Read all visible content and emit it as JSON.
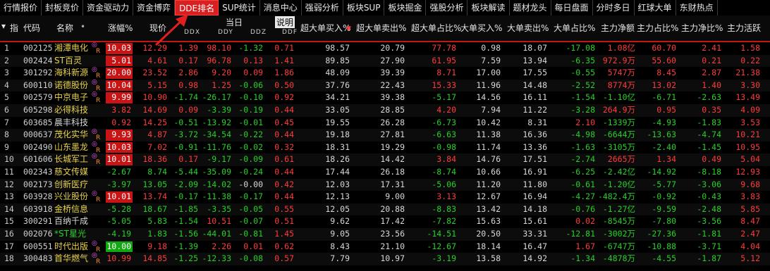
{
  "tabs": [
    "行情报价",
    "封板竞价",
    "资金驱动力",
    "资金博弈",
    "DDE排名",
    "SUP统计",
    "消息中心",
    "强弱分析",
    "板块SUP",
    "板块掘金",
    "强股分析",
    "板块解读",
    "题材龙头",
    "每日盘面",
    "分时多日",
    "红球大单",
    "东财热点"
  ],
  "active_tab": "DDE排名",
  "header": {
    "index": "指",
    "code": "代码",
    "name": "名称",
    "dot": "•",
    "change": "涨幅%",
    "price": "现价",
    "today": "当日",
    "explain": "说明",
    "ddx": "DDX",
    "ddy": "DDY",
    "ddz": "DDZ",
    "ddf": "DDF",
    "cols": [
      "超大单买入%",
      "超大单卖出%",
      "超大单占比%",
      "大单买入%",
      "大单卖出%",
      "大单占比%",
      "主力净额",
      "主力占比%",
      "主力净比%",
      "主力活跃"
    ]
  },
  "rows": [
    {
      "i": "1",
      "code": "002125",
      "name": "湘潭电化",
      "badge": "R",
      "chg": "10.03",
      "chgbox": "red",
      "price": "12.29",
      "ddx": "1.39",
      "ddy": "98.10",
      "ddz": "-1.32",
      "ddf": "0.71",
      "c1": "98.57",
      "c2": "20.79",
      "c3": "77.78",
      "c4": "0.98",
      "c5": "18.07",
      "c6": "-17.08",
      "c7": "1.08亿",
      "c8": "60.70",
      "c9": "2.41",
      "c10": "1.58"
    },
    {
      "i": "2",
      "code": "002424",
      "name": "ST百灵",
      "badge": "",
      "chg": "5.01",
      "chgbox": "red",
      "price": "4.61",
      "ddx": "0.17",
      "ddy": "96.78",
      "ddz": "0.13",
      "ddf": "1.41",
      "c1": "89.85",
      "c2": "27.90",
      "c3": "61.95",
      "c4": "7.59",
      "c5": "13.94",
      "c6": "-6.35",
      "c7": "972.9万",
      "c8": "55.60",
      "c9": "0.21",
      "c10": "0.22"
    },
    {
      "i": "3",
      "code": "301292",
      "name": "海科新源",
      "badge": "R",
      "chg": "20.00",
      "chgbox": "red",
      "price": "23.52",
      "ddx": "2.86",
      "ddy": "9.20",
      "ddz": "0.09",
      "ddf": "1.86",
      "c1": "48.09",
      "c2": "39.39",
      "c3": "8.71",
      "c4": "17.00",
      "c5": "17.55",
      "c6": "-0.55",
      "c7": "5747万",
      "c8": "8.45",
      "c9": "2.87",
      "c10": "21.38"
    },
    {
      "i": "4",
      "code": "600110",
      "name": "诺德股份",
      "badge": "R",
      "chg": "10.04",
      "chgbox": "red",
      "price": "5.15",
      "ddx": "0.98",
      "ddy": "1.25",
      "ddz": "-0.06",
      "ddf": "0.50",
      "c1": "37.76",
      "c2": "22.43",
      "c3": "15.33",
      "c4": "11.96",
      "c5": "14.48",
      "c6": "-2.52",
      "c7": "8774万",
      "c8": "13.02",
      "c9": "1.40",
      "c10": "3.30"
    },
    {
      "i": "5",
      "code": "002579",
      "name": "中京电子",
      "badge": "R",
      "chg": "9.99",
      "chgbox": "red",
      "price": "10.90",
      "ddx": "-1.74",
      "ddy": "-26.17",
      "ddz": "-0.10",
      "ddf": "0.92",
      "c1": "34.21",
      "c2": "39.38",
      "c3": "-5.17",
      "c4": "14.56",
      "c5": "16.11",
      "c6": "-1.54",
      "c7": "-1.10亿",
      "c8": "-6.71",
      "c9": "-2.63",
      "c10": "13.49"
    },
    {
      "i": "6",
      "code": "605298",
      "name": "必得科技",
      "badge": "",
      "chg": "3.82",
      "chgbox": "",
      "price": "14.69",
      "ddx": "0.09",
      "ddy": "-3.39",
      "ddz": "-0.19",
      "ddf": "0.44",
      "c1": "33.05",
      "c2": "28.85",
      "c3": "4.20",
      "c4": "7.94",
      "c5": "11.22",
      "c6": "-3.28",
      "c7": "264.9万",
      "c8": "0.95",
      "c9": "0.35",
      "c10": "4.09"
    },
    {
      "i": "7",
      "code": "603685",
      "name": "晨丰科技",
      "badge": "",
      "chg": "0.92",
      "chgbox": "",
      "price": "14.25",
      "ddx": "-0.51",
      "ddy": "-13.92",
      "ddz": "-0.01",
      "ddf": "0.45",
      "c1": "19.55",
      "c2": "26.28",
      "c3": "-6.73",
      "c4": "10.42",
      "c5": "8.31",
      "c6": "2.10",
      "c7": "-1339万",
      "c8": "-4.93",
      "c9": "-1.83",
      "c10": "3.53"
    },
    {
      "i": "8",
      "code": "000637",
      "name": "茂化实华",
      "badge": "R",
      "chg": "9.93",
      "chgbox": "red",
      "price": "4.87",
      "ddx": "-3.72",
      "ddy": "-34.54",
      "ddz": "-0.22",
      "ddf": "0.44",
      "c1": "19.18",
      "c2": "27.81",
      "c3": "-6.63",
      "c4": "11.38",
      "c5": "16.36",
      "c6": "-4.98",
      "c7": "-6644万",
      "c8": "-13.63",
      "c9": "-4.74",
      "c10": "10.21"
    },
    {
      "i": "9",
      "code": "002490",
      "name": "山东墨龙",
      "badge": "R",
      "chg": "10.03",
      "chgbox": "red",
      "price": "7.02",
      "ddx": "-0.91",
      "ddy": "-11.76",
      "ddz": "-0.02",
      "ddf": "0.32",
      "c1": "18.31",
      "c2": "19.29",
      "c3": "-0.98",
      "c4": "11.74",
      "c5": "13.36",
      "c6": "-1.63",
      "c7": "-3105万",
      "c8": "-2.40",
      "c9": "-1.45",
      "c10": "10.95"
    },
    {
      "i": "10",
      "code": "601606",
      "name": "长城军工",
      "badge": "R",
      "chg": "10.01",
      "chgbox": "red",
      "price": "18.36",
      "ddx": "0.17",
      "ddy": "-9.17",
      "ddz": "-0.09",
      "ddf": "0.61",
      "c1": "18.26",
      "c2": "14.42",
      "c3": "3.84",
      "c4": "14.76",
      "c5": "17.51",
      "c6": "-2.74",
      "c7": "2665万",
      "c8": "1.34",
      "c9": "0.49",
      "c10": "5.04"
    },
    {
      "i": "11",
      "code": "002343",
      "name": "慈文传媒",
      "badge": "",
      "chg": "-2.67",
      "chgbox": "",
      "price": "8.74",
      "ddx": "-5.44",
      "ddy": "-35.09",
      "ddz": "-0.24",
      "ddf": "0.44",
      "c1": "17.44",
      "c2": "26.18",
      "c3": "-8.74",
      "c4": "10.66",
      "c5": "16.91",
      "c6": "-6.25",
      "c7": "-2.42亿",
      "c8": "-14.92",
      "c9": "-8.18",
      "c10": "12.93"
    },
    {
      "i": "12",
      "code": "002173",
      "name": "创新医疗",
      "badge": "",
      "chg": "-3.97",
      "chgbox": "",
      "price": "13.05",
      "ddx": "-2.09",
      "ddy": "-14.02",
      "ddz": "-0.00",
      "ddf": "0.42",
      "c1": "12.03",
      "c2": "17.31",
      "c3": "-5.06",
      "c4": "11.20",
      "c5": "11.80",
      "c6": "-0.61",
      "c7": "-1.20亿",
      "c8": "-5.77",
      "c9": "-3.06",
      "c10": "9.68"
    },
    {
      "i": "13",
      "code": "603928",
      "name": "兴业股份",
      "badge": "R",
      "chg": "10.01",
      "chgbox": "red",
      "price": "13.74",
      "ddx": "-0.17",
      "ddy": "-11.38",
      "ddz": "-0.17",
      "ddf": "0.44",
      "c1": "12.13",
      "c2": "9.00",
      "c3": "3.13",
      "c4": "12.67",
      "c5": "16.94",
      "c6": "-4.27",
      "c7": "-482.4万",
      "c8": "-0.92",
      "c9": "-0.43",
      "c10": "3.83"
    },
    {
      "i": "14",
      "code": "603918",
      "name": "金桥信息",
      "badge": "",
      "chg": "-5.28",
      "chgbox": "",
      "price": "18.67",
      "ddx": "-1.85",
      "ddy": "-3.35",
      "ddz": "-0.05",
      "ddf": "0.55",
      "c1": "12.05",
      "c2": "20.88",
      "c3": "-8.83",
      "c4": "13.42",
      "c5": "14.18",
      "c6": "-0.76",
      "c7": "-1.27亿",
      "c8": "-9.59",
      "c9": "-2.48",
      "c10": "5.85"
    },
    {
      "i": "15",
      "code": "300291",
      "name": "百纳千成",
      "badge": "",
      "chg": "-5.05",
      "chgbox": "",
      "price": "5.83",
      "ddx": "-1.54",
      "ddy": "10.51",
      "ddz": "-0.07",
      "ddf": "0.51",
      "c1": "9.62",
      "c2": "17.42",
      "c3": "-7.82",
      "c4": "15.63",
      "c5": "15.61",
      "c6": "0.02",
      "c7": "-8545万",
      "c8": "-7.80",
      "c9": "-3.56",
      "c10": "8.47"
    },
    {
      "i": "16",
      "code": "002076",
      "name": "*ST星光",
      "badge": "",
      "chg": "-4.19",
      "chgbox": "",
      "price": "1.83",
      "ddx": "-1.56",
      "ddy": "-44.01",
      "ddz": "-0.81",
      "ddf": "1.45",
      "c1": "9.05",
      "c2": "23.56",
      "c3": "-14.51",
      "c4": "20.50",
      "c5": "33.31",
      "c6": "-12.81",
      "c7": "-3002万",
      "c8": "-27.36",
      "c9": "-1.81",
      "c10": "2.47"
    },
    {
      "i": "17",
      "code": "600551",
      "name": "时代出版",
      "badge": "R",
      "chg": "10.00",
      "chgbox": "green",
      "price": "9.18",
      "ddx": "-1.39",
      "ddy": "2.26",
      "ddz": "0.01",
      "ddf": "0.62",
      "c1": "8.43",
      "c2": "21.10",
      "c3": "-12.67",
      "c4": "18.14",
      "c5": "16.47",
      "c6": "1.67",
      "c7": "-6747万",
      "c8": "-10.88",
      "c9": "-3.71",
      "c10": "4.04"
    },
    {
      "i": "18",
      "code": "300483",
      "name": "首华燃气",
      "badge": "R",
      "chg": "10.99",
      "chgbox": "",
      "price": "14.85",
      "ddx": "-1.25",
      "ddy": "-12.33",
      "ddz": "-0.08",
      "ddf": "0.57",
      "c1": "7.79",
      "c2": "10.97",
      "c3": "-3.19",
      "c4": "13.58",
      "c5": "14.92",
      "c6": "-1.34",
      "c7": "-4878万",
      "c8": "-4.55",
      "c9": "-1.87",
      "c10": "5.12"
    }
  ]
}
